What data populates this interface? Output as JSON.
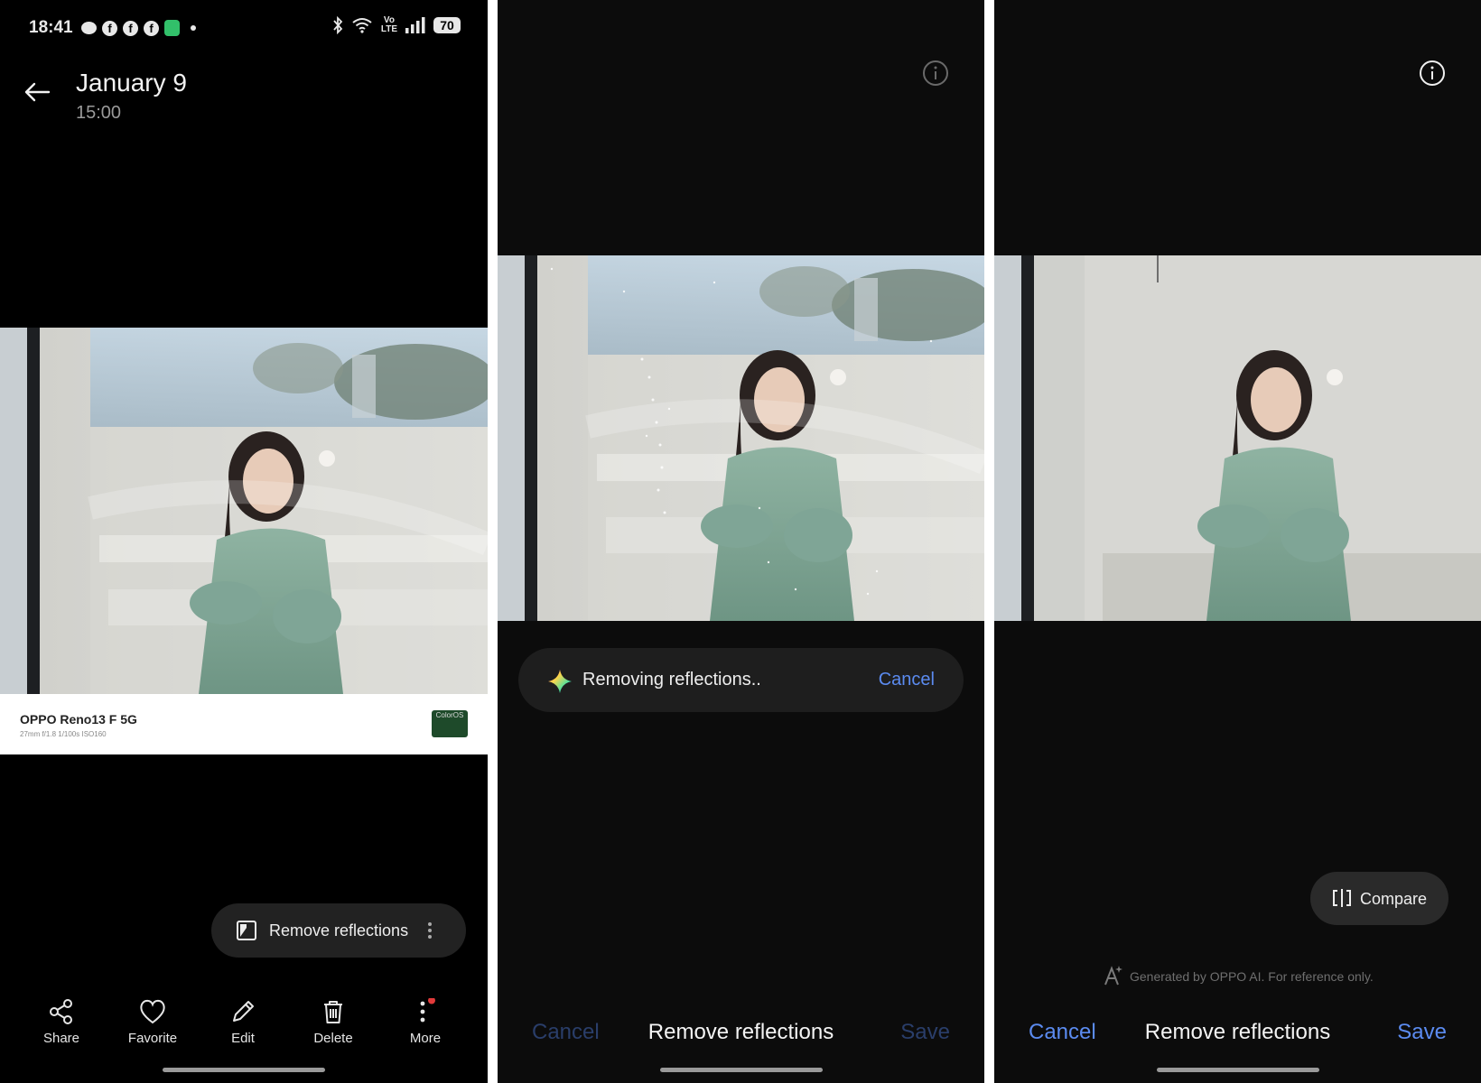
{
  "colors": {
    "accent": "#5b8bf0",
    "accent_dim": "#2a3e6a",
    "panel_bg": "#0c0c0c"
  },
  "status_bar": {
    "time": "18:41",
    "battery": "70",
    "volte_top": "Vo",
    "volte_bottom": "LTE"
  },
  "viewer": {
    "title": "January 9",
    "subtitle": "15:00",
    "camera_model": "OPPO Reno13 F 5G",
    "camera_specs": "27mm  f/1.8  1/100s  ISO160",
    "watermark_badge": "ColorOS",
    "action_pill_label": "Remove reflections",
    "toolbar": [
      {
        "label": "Share",
        "icon": "share-icon"
      },
      {
        "label": "Favorite",
        "icon": "heart-icon"
      },
      {
        "label": "Edit",
        "icon": "pencil-icon"
      },
      {
        "label": "Delete",
        "icon": "trash-icon"
      },
      {
        "label": "More",
        "icon": "more-vertical-icon"
      }
    ]
  },
  "processing": {
    "progress_text": "Removing reflections..",
    "cancel_label": "Cancel",
    "bottom": {
      "cancel": "Cancel",
      "title": "Remove reflections",
      "save": "Save"
    }
  },
  "result": {
    "compare_label": "Compare",
    "disclaimer": "Generated by OPPO AI. For reference only.",
    "bottom": {
      "cancel": "Cancel",
      "title": "Remove reflections",
      "save": "Save"
    }
  }
}
